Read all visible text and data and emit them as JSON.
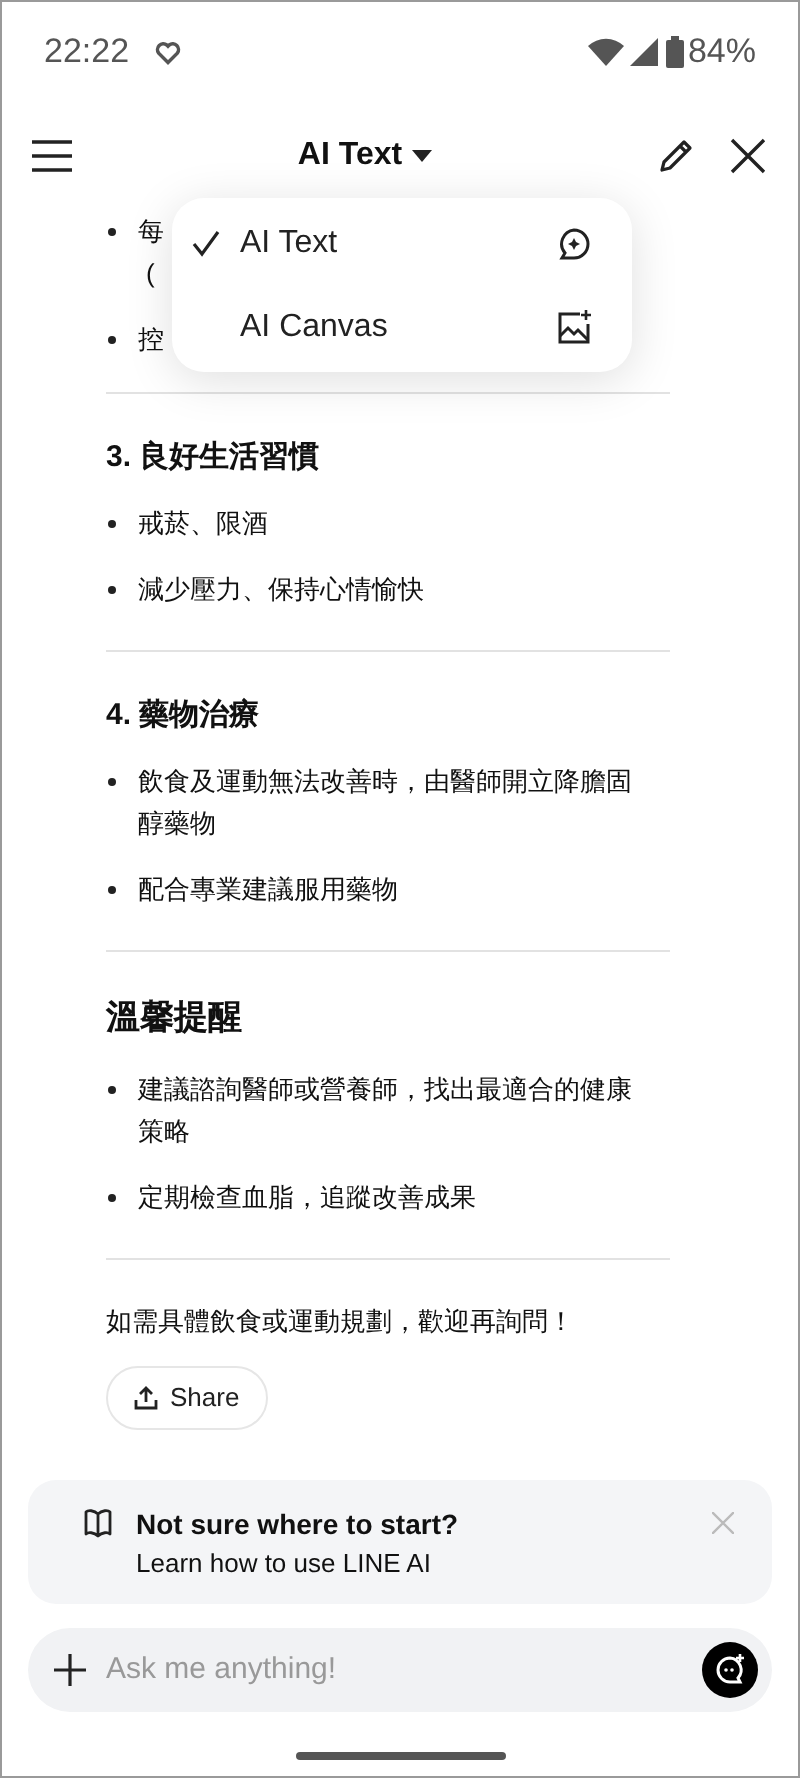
{
  "status_bar": {
    "time": "22:22",
    "battery": "84%"
  },
  "header": {
    "title": "AI Text"
  },
  "mode_menu": [
    {
      "label": "AI Text",
      "selected": true,
      "kind": "text"
    },
    {
      "label": "AI Canvas",
      "selected": false,
      "kind": "canvas"
    }
  ],
  "sections": [
    {
      "items": [
        {
          "lines": [
            "每",
            "("
          ]
        },
        {
          "lines": [
            "控"
          ]
        }
      ]
    },
    {
      "heading": "3. 良好生活習慣",
      "kind": "minor",
      "items": [
        {
          "lines": [
            "戒菸、限酒"
          ]
        },
        {
          "lines": [
            "減少壓力、保持心情愉快"
          ]
        }
      ]
    },
    {
      "heading": "4. 藥物治療",
      "kind": "minor",
      "items": [
        {
          "lines": [
            "飲食及運動無法改善時，由醫師開立降膽固醇藥物"
          ]
        },
        {
          "lines": [
            "配合專業建議服用藥物"
          ]
        }
      ]
    },
    {
      "heading": "溫馨提醒",
      "kind": "major",
      "items": [
        {
          "lines": [
            "建議諮詢醫師或營養師，找出最適合的健康策略"
          ]
        },
        {
          "lines": [
            "定期檢查血脂，追蹤改善成果"
          ]
        }
      ]
    }
  ],
  "closing": "如需具體飲食或運動規劃，歡迎再詢問！",
  "share_button": "Share",
  "hint_card": {
    "title": "Not sure where to start?",
    "subtitle": "Learn how to use LINE AI"
  },
  "input": {
    "placeholder": "Ask me anything!"
  }
}
